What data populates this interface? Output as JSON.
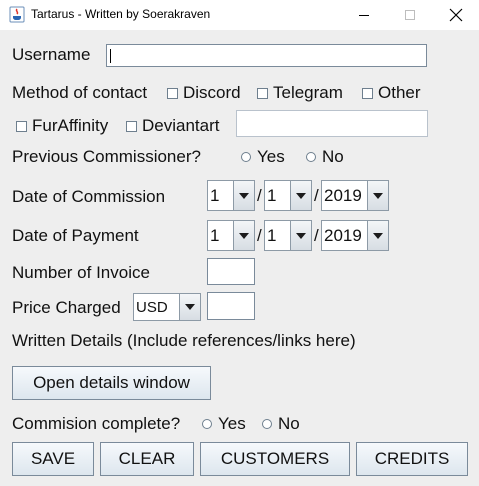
{
  "window": {
    "title": "Tartarus - Written by Soerakraven"
  },
  "form": {
    "username_label": "Username",
    "username_value": "",
    "contact_label": "Method of contact",
    "contact_options": [
      "Discord",
      "Telegram",
      "Other",
      "FurAffinity",
      "Deviantart"
    ],
    "contact_other_value": "",
    "previous_label": "Previous Commissioner?",
    "previous_options": [
      "Yes",
      "No"
    ],
    "commission_date_label": "Date of Commission",
    "commission_date": {
      "day": "1",
      "month": "1",
      "year": "2019"
    },
    "payment_date_label": "Date of Payment",
    "payment_date": {
      "day": "1",
      "month": "1",
      "year": "2019"
    },
    "date_separator": "/",
    "invoice_label": "Number of Invoice",
    "invoice_value": "",
    "price_label": "Price Charged",
    "currency": "USD",
    "price_value": "",
    "details_label": "Written Details (Include references/links here)",
    "details_button": "Open details window",
    "complete_label": "Commision complete?",
    "complete_options": [
      "Yes",
      "No"
    ]
  },
  "actions": {
    "save": "SAVE",
    "clear": "CLEAR",
    "customers": "CUSTOMERS",
    "credits": "CREDITS"
  }
}
